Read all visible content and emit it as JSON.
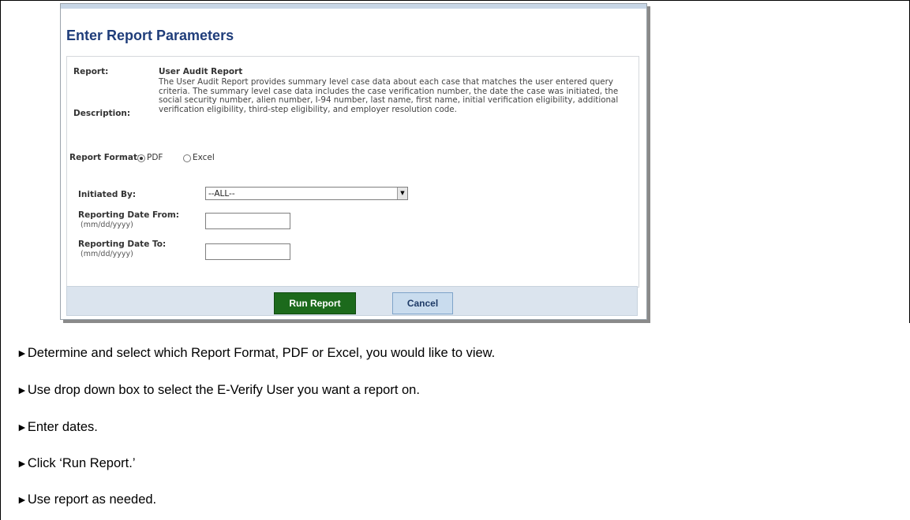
{
  "form": {
    "title": "Enter Report Parameters",
    "report_label": "Report:",
    "report_name": "User Audit Report",
    "description_label": "Description:",
    "description": "The User Audit Report provides summary level case data about each case that matches the user entered query criteria. The summary level case data includes the case verification number, the date the case was initiated, the social security number, alien number, I-94 number, last name, first name, initial verification eligibility, additional verification eligibility, third-step eligibility, and employer resolution code.",
    "format_label": "Report Format:",
    "format_options": [
      {
        "label": "PDF",
        "selected": true
      },
      {
        "label": "Excel",
        "selected": false
      }
    ],
    "initiated_by_label": "Initiated By:",
    "initiated_by_value": "--ALL--",
    "date_from_label": "Reporting Date From:",
    "date_from_hint": "(mm/dd/yyyy)",
    "date_from_value": "",
    "date_to_label": "Reporting Date To:",
    "date_to_hint": "(mm/dd/yyyy)",
    "date_to_value": "",
    "run_button": "Run Report",
    "cancel_button": "Cancel"
  },
  "instructions": {
    "bullet_icon": "right-pointer-triangle",
    "steps": [
      "Determine and select which Report Format, PDF or Excel, you would like to view.",
      "Use drop down box to select the E-Verify User you want a report on.",
      "Enter dates.",
      "Click ‘Run Report.’",
      "Use report as needed."
    ]
  },
  "colors": {
    "title": "#1f3d7a",
    "run_button": "#1c6a1c",
    "cancel_button": "#c9dcee",
    "button_bar": "#dbe4ee"
  }
}
